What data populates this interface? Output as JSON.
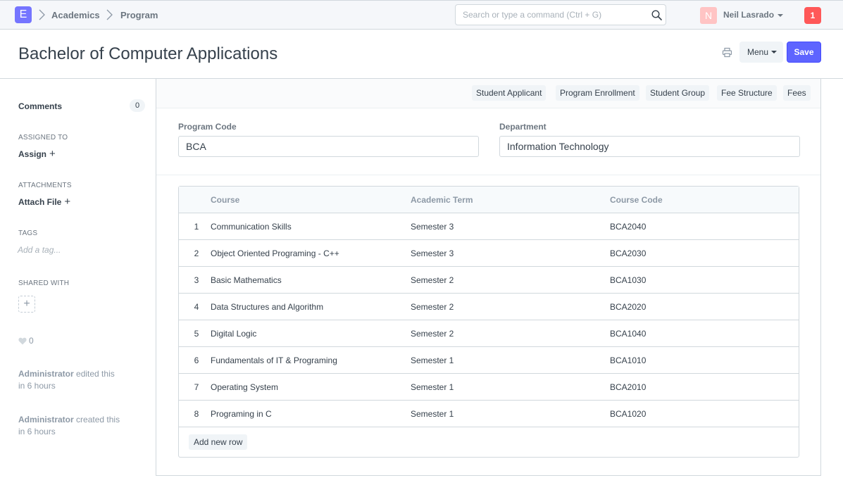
{
  "navbar": {
    "logo_letter": "E",
    "breadcrumbs": [
      "Academics",
      "Program"
    ],
    "search_placeholder": "Search or type a command (Ctrl + G)",
    "user_initial": "N",
    "user_name": "Neil Lasrado",
    "notification_count": "1"
  },
  "page": {
    "title": "Bachelor of Computer Applications",
    "menu_label": "Menu",
    "save_label": "Save"
  },
  "sidebar": {
    "comments_label": "Comments",
    "comments_count": "0",
    "assigned_to_label": "ASSIGNED TO",
    "assign_label": "Assign",
    "attachments_label": "ATTACHMENTS",
    "attach_label": "Attach File",
    "tags_label": "TAGS",
    "tag_placeholder": "Add a tag...",
    "shared_with_label": "SHARED WITH",
    "likes_count": "0",
    "activity": [
      {
        "user": "Administrator",
        "action": "edited this",
        "time": "in 6 hours"
      },
      {
        "user": "Administrator",
        "action": "created this",
        "time": "in 6 hours"
      }
    ]
  },
  "links": [
    "Student Applicant",
    "Program Enrollment",
    "Student Group",
    "Fee Structure",
    "Fees"
  ],
  "fields": {
    "program_code_label": "Program Code",
    "program_code_value": "BCA",
    "department_label": "Department",
    "department_value": "Information Technology"
  },
  "grid": {
    "columns": [
      "Course",
      "Academic Term",
      "Course Code"
    ],
    "rows": [
      {
        "idx": "1",
        "course": "Communication Skills",
        "term": "Semester 3",
        "code": "BCA2040"
      },
      {
        "idx": "2",
        "course": "Object Oriented Programing - C++",
        "term": "Semester 3",
        "code": "BCA2030"
      },
      {
        "idx": "3",
        "course": "Basic Mathematics",
        "term": "Semester 2",
        "code": "BCA1030"
      },
      {
        "idx": "4",
        "course": "Data Structures and Algorithm",
        "term": "Semester 2",
        "code": "BCA2020"
      },
      {
        "idx": "5",
        "course": "Digital Logic",
        "term": "Semester 2",
        "code": "BCA1040"
      },
      {
        "idx": "6",
        "course": "Fundamentals of IT & Programing",
        "term": "Semester 1",
        "code": "BCA1010"
      },
      {
        "idx": "7",
        "course": "Operating System",
        "term": "Semester 1",
        "code": "BCA2010"
      },
      {
        "idx": "8",
        "course": "Programing in C",
        "term": "Semester 1",
        "code": "BCA1020"
      }
    ],
    "add_row_label": "Add new row"
  },
  "colors": {
    "accent": "#5e64ff",
    "logo": "#7575ff",
    "notification": "#ff5858",
    "avatar": "#ffc4c4"
  }
}
